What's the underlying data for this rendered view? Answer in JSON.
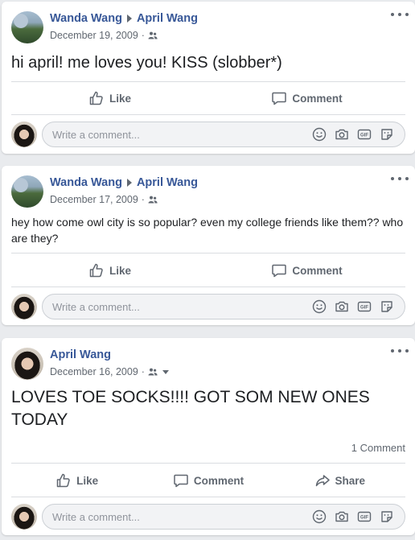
{
  "posts": [
    {
      "author": "Wanda Wang",
      "recipient": "April Wang",
      "date": "December 19, 2009",
      "separator": "·",
      "text": "hi april! me loves you! KISS (slobber*)",
      "actions": {
        "like": "Like",
        "comment": "Comment"
      },
      "comment_placeholder": "Write a comment..."
    },
    {
      "author": "Wanda Wang",
      "recipient": "April Wang",
      "date": "December 17, 2009",
      "separator": "·",
      "text": "hey how come owl city is so popular? even my college friends like them?? who are they?",
      "actions": {
        "like": "Like",
        "comment": "Comment"
      },
      "comment_placeholder": "Write a comment..."
    },
    {
      "author": "April Wang",
      "date": "December 16, 2009",
      "separator": "·",
      "text": "LOVES TOE SOCKS!!!! GOT SOM NEW ONES TODAY",
      "comment_count": "1 Comment",
      "actions": {
        "like": "Like",
        "comment": "Comment",
        "share": "Share"
      },
      "comment_placeholder": "Write a comment..."
    }
  ],
  "colors": {
    "link": "#385898",
    "secondary_text": "#606770",
    "background": "#e9ebee",
    "card": "#ffffff"
  },
  "icons": {
    "audience": "friends-icon",
    "more": "more-options-icon",
    "like": "thumbs-up-icon",
    "comment": "speech-bubble-icon",
    "share": "share-arrow-icon",
    "emoji": "smiley-icon",
    "camera": "camera-icon",
    "gif": "gif-icon",
    "sticker": "sticker-icon"
  }
}
